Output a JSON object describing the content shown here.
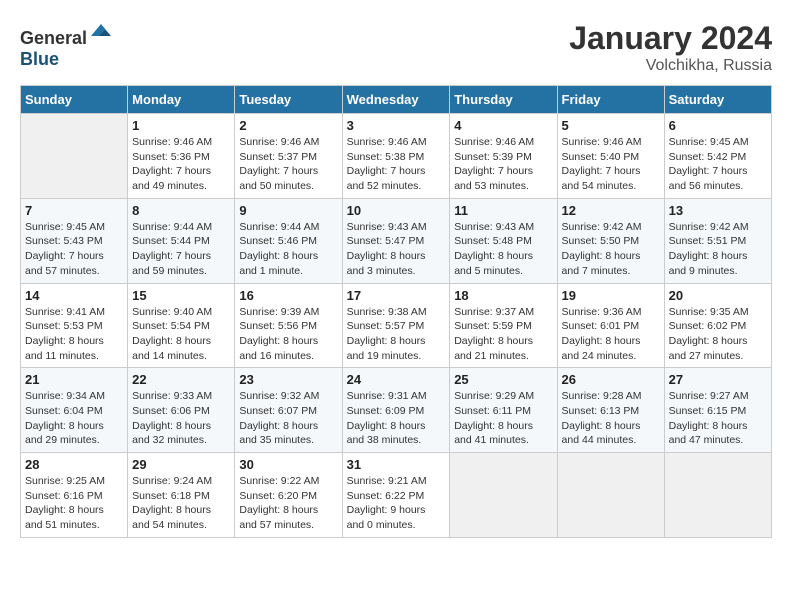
{
  "header": {
    "logo_general": "General",
    "logo_blue": "Blue",
    "month": "January 2024",
    "location": "Volchikha, Russia"
  },
  "weekdays": [
    "Sunday",
    "Monday",
    "Tuesday",
    "Wednesday",
    "Thursday",
    "Friday",
    "Saturday"
  ],
  "weeks": [
    [
      {
        "day": "",
        "info": ""
      },
      {
        "day": "1",
        "info": "Sunrise: 9:46 AM\nSunset: 5:36 PM\nDaylight: 7 hours\nand 49 minutes."
      },
      {
        "day": "2",
        "info": "Sunrise: 9:46 AM\nSunset: 5:37 PM\nDaylight: 7 hours\nand 50 minutes."
      },
      {
        "day": "3",
        "info": "Sunrise: 9:46 AM\nSunset: 5:38 PM\nDaylight: 7 hours\nand 52 minutes."
      },
      {
        "day": "4",
        "info": "Sunrise: 9:46 AM\nSunset: 5:39 PM\nDaylight: 7 hours\nand 53 minutes."
      },
      {
        "day": "5",
        "info": "Sunrise: 9:46 AM\nSunset: 5:40 PM\nDaylight: 7 hours\nand 54 minutes."
      },
      {
        "day": "6",
        "info": "Sunrise: 9:45 AM\nSunset: 5:42 PM\nDaylight: 7 hours\nand 56 minutes."
      }
    ],
    [
      {
        "day": "7",
        "info": "Sunrise: 9:45 AM\nSunset: 5:43 PM\nDaylight: 7 hours\nand 57 minutes."
      },
      {
        "day": "8",
        "info": "Sunrise: 9:44 AM\nSunset: 5:44 PM\nDaylight: 7 hours\nand 59 minutes."
      },
      {
        "day": "9",
        "info": "Sunrise: 9:44 AM\nSunset: 5:46 PM\nDaylight: 8 hours\nand 1 minute."
      },
      {
        "day": "10",
        "info": "Sunrise: 9:43 AM\nSunset: 5:47 PM\nDaylight: 8 hours\nand 3 minutes."
      },
      {
        "day": "11",
        "info": "Sunrise: 9:43 AM\nSunset: 5:48 PM\nDaylight: 8 hours\nand 5 minutes."
      },
      {
        "day": "12",
        "info": "Sunrise: 9:42 AM\nSunset: 5:50 PM\nDaylight: 8 hours\nand 7 minutes."
      },
      {
        "day": "13",
        "info": "Sunrise: 9:42 AM\nSunset: 5:51 PM\nDaylight: 8 hours\nand 9 minutes."
      }
    ],
    [
      {
        "day": "14",
        "info": "Sunrise: 9:41 AM\nSunset: 5:53 PM\nDaylight: 8 hours\nand 11 minutes."
      },
      {
        "day": "15",
        "info": "Sunrise: 9:40 AM\nSunset: 5:54 PM\nDaylight: 8 hours\nand 14 minutes."
      },
      {
        "day": "16",
        "info": "Sunrise: 9:39 AM\nSunset: 5:56 PM\nDaylight: 8 hours\nand 16 minutes."
      },
      {
        "day": "17",
        "info": "Sunrise: 9:38 AM\nSunset: 5:57 PM\nDaylight: 8 hours\nand 19 minutes."
      },
      {
        "day": "18",
        "info": "Sunrise: 9:37 AM\nSunset: 5:59 PM\nDaylight: 8 hours\nand 21 minutes."
      },
      {
        "day": "19",
        "info": "Sunrise: 9:36 AM\nSunset: 6:01 PM\nDaylight: 8 hours\nand 24 minutes."
      },
      {
        "day": "20",
        "info": "Sunrise: 9:35 AM\nSunset: 6:02 PM\nDaylight: 8 hours\nand 27 minutes."
      }
    ],
    [
      {
        "day": "21",
        "info": "Sunrise: 9:34 AM\nSunset: 6:04 PM\nDaylight: 8 hours\nand 29 minutes."
      },
      {
        "day": "22",
        "info": "Sunrise: 9:33 AM\nSunset: 6:06 PM\nDaylight: 8 hours\nand 32 minutes."
      },
      {
        "day": "23",
        "info": "Sunrise: 9:32 AM\nSunset: 6:07 PM\nDaylight: 8 hours\nand 35 minutes."
      },
      {
        "day": "24",
        "info": "Sunrise: 9:31 AM\nSunset: 6:09 PM\nDaylight: 8 hours\nand 38 minutes."
      },
      {
        "day": "25",
        "info": "Sunrise: 9:29 AM\nSunset: 6:11 PM\nDaylight: 8 hours\nand 41 minutes."
      },
      {
        "day": "26",
        "info": "Sunrise: 9:28 AM\nSunset: 6:13 PM\nDaylight: 8 hours\nand 44 minutes."
      },
      {
        "day": "27",
        "info": "Sunrise: 9:27 AM\nSunset: 6:15 PM\nDaylight: 8 hours\nand 47 minutes."
      }
    ],
    [
      {
        "day": "28",
        "info": "Sunrise: 9:25 AM\nSunset: 6:16 PM\nDaylight: 8 hours\nand 51 minutes."
      },
      {
        "day": "29",
        "info": "Sunrise: 9:24 AM\nSunset: 6:18 PM\nDaylight: 8 hours\nand 54 minutes."
      },
      {
        "day": "30",
        "info": "Sunrise: 9:22 AM\nSunset: 6:20 PM\nDaylight: 8 hours\nand 57 minutes."
      },
      {
        "day": "31",
        "info": "Sunrise: 9:21 AM\nSunset: 6:22 PM\nDaylight: 9 hours\nand 0 minutes."
      },
      {
        "day": "",
        "info": ""
      },
      {
        "day": "",
        "info": ""
      },
      {
        "day": "",
        "info": ""
      }
    ]
  ]
}
